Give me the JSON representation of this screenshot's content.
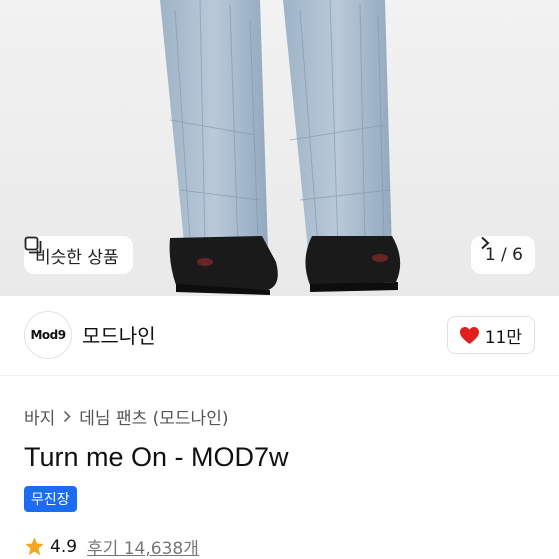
{
  "hero": {
    "similar_label": "비슷한 상품",
    "pager": "1 / 6"
  },
  "brand": {
    "logo_text": "Mod9",
    "name": "모드나인",
    "likes": "11만"
  },
  "breadcrumb": {
    "category": "바지",
    "subcategory": "데님 팬츠 (모드나인)"
  },
  "product": {
    "title": "Turn me On - MOD7w",
    "badge": "무진장"
  },
  "rating": {
    "score": "4.9",
    "reviews": "후기 14,638개"
  },
  "colors": {
    "accent_blue": "#1c6cf2",
    "heart_red": "#e0201e",
    "star_orange": "#f5a623"
  }
}
